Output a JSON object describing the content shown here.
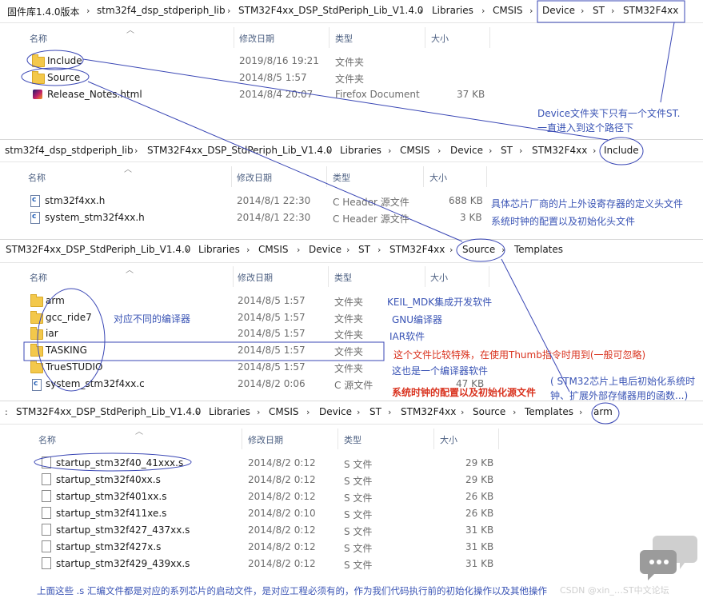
{
  "panel1": {
    "breadcrumbs": [
      "固件库1.4.0版本",
      "stm32f4_dsp_stdperiph_lib",
      "STM32F4xx_DSP_StdPeriph_Lib_V1.4.0",
      "Libraries",
      "CMSIS",
      "Device",
      "ST",
      "STM32F4xx"
    ],
    "headers": {
      "name": "名称",
      "date": "修改日期",
      "type": "类型",
      "size": "大小"
    },
    "rows": [
      {
        "name": "Include",
        "date": "2019/8/16 19:21",
        "type": "文件夹",
        "size": ""
      },
      {
        "name": "Source",
        "date": "2014/8/5 1:57",
        "type": "文件夹",
        "size": ""
      },
      {
        "name": "Release_Notes.html",
        "date": "2014/8/4 20:07",
        "type": "Firefox Document",
        "size": "37 KB"
      }
    ]
  },
  "panel2": {
    "breadcrumbs": [
      "stm32f4_dsp_stdperiph_lib",
      "STM32F4xx_DSP_StdPeriph_Lib_V1.4.0",
      "Libraries",
      "CMSIS",
      "Device",
      "ST",
      "STM32F4xx",
      "Include"
    ],
    "headers": {
      "name": "名称",
      "date": "修改日期",
      "type": "类型",
      "size": "大小"
    },
    "rows": [
      {
        "name": "stm32f4xx.h",
        "date": "2014/8/1 22:30",
        "type": "C Header 源文件",
        "size": "688 KB"
      },
      {
        "name": "system_stm32f4xx.h",
        "date": "2014/8/1 22:30",
        "type": "C Header 源文件",
        "size": "3 KB"
      }
    ]
  },
  "panel3": {
    "breadcrumbs": [
      "STM32F4xx_DSP_StdPeriph_Lib_V1.4.0",
      "Libraries",
      "CMSIS",
      "Device",
      "ST",
      "STM32F4xx",
      "Source",
      "Templates"
    ],
    "headers": {
      "name": "名称",
      "date": "修改日期",
      "type": "类型",
      "size": "大小"
    },
    "rows": [
      {
        "name": "arm",
        "date": "2014/8/5 1:57",
        "type": "文件夹",
        "size": ""
      },
      {
        "name": "gcc_ride7",
        "date": "2014/8/5 1:57",
        "type": "文件夹",
        "size": ""
      },
      {
        "name": "iar",
        "date": "2014/8/5 1:57",
        "type": "文件夹",
        "size": ""
      },
      {
        "name": "TASKING",
        "date": "2014/8/5 1:57",
        "type": "文件夹",
        "size": ""
      },
      {
        "name": "TrueSTUDIO",
        "date": "2014/8/5 1:57",
        "type": "文件夹",
        "size": ""
      },
      {
        "name": "system_stm32f4xx.c",
        "date": "2014/8/2 0:06",
        "type": "C 源文件",
        "size": "47 KB"
      }
    ]
  },
  "panel4": {
    "breadcrumbs": [
      "STM32F4xx_DSP_StdPeriph_Lib_V1.4.0",
      "Libraries",
      "CMSIS",
      "Device",
      "ST",
      "STM32F4xx",
      "Source",
      "Templates",
      "arm"
    ],
    "headers": {
      "name": "名称",
      "date": "修改日期",
      "type": "类型",
      "size": "大小"
    },
    "rows": [
      {
        "name": "startup_stm32f40_41xxx.s",
        "date": "2014/8/2 0:12",
        "type": "S 文件",
        "size": "29 KB"
      },
      {
        "name": "startup_stm32f40xx.s",
        "date": "2014/8/2 0:12",
        "type": "S 文件",
        "size": "29 KB"
      },
      {
        "name": "startup_stm32f401xx.s",
        "date": "2014/8/2 0:12",
        "type": "S 文件",
        "size": "26 KB"
      },
      {
        "name": "startup_stm32f411xe.s",
        "date": "2014/8/2 0:10",
        "type": "S 文件",
        "size": "26 KB"
      },
      {
        "name": "startup_stm32f427_437xx.s",
        "date": "2014/8/2 0:12",
        "type": "S 文件",
        "size": "31 KB"
      },
      {
        "name": "startup_stm32f427x.s",
        "date": "2014/8/2 0:12",
        "type": "S 文件",
        "size": "31 KB"
      },
      {
        "name": "startup_stm32f429_439xx.s",
        "date": "2014/8/2 0:12",
        "type": "S 文件",
        "size": "31 KB"
      }
    ]
  },
  "annotations": {
    "device_note_1": "Device文件夹下只有一个文件ST.",
    "device_note_2": "一直进入到这个路径下",
    "stm32f4xx_h_note": "具体芯片厂商的片上外设寄存器的定义头文件",
    "system_h_note": "系统时钟的配置以及初始化头文件",
    "compilers_note": "对应不同的编译器",
    "arm_note": "KEIL_MDK集成开发软件",
    "gcc_note": "GNU编译器",
    "iar_note": "IAR软件",
    "tasking_note": "这个文件比较特殊，在使用Thumb指令时用到(一般可忽略)",
    "truestudio_note": "这也是一个编译器软件",
    "system_c_note": "系统时钟的配置以及初始化源文件",
    "startup_note_1": "( STM32芯片上电后初始化系统时",
    "startup_note_2": "钟、扩展外部存储器用的函数...)",
    "bottom_note": "上面这些 .s 汇编文件都是对应的系列芯片的启动文件，是对应工程必须有的，作为我们代码执行前的初始化操作以及其他操作"
  },
  "watermark": "CSDN @xin_…ST中文论坛"
}
